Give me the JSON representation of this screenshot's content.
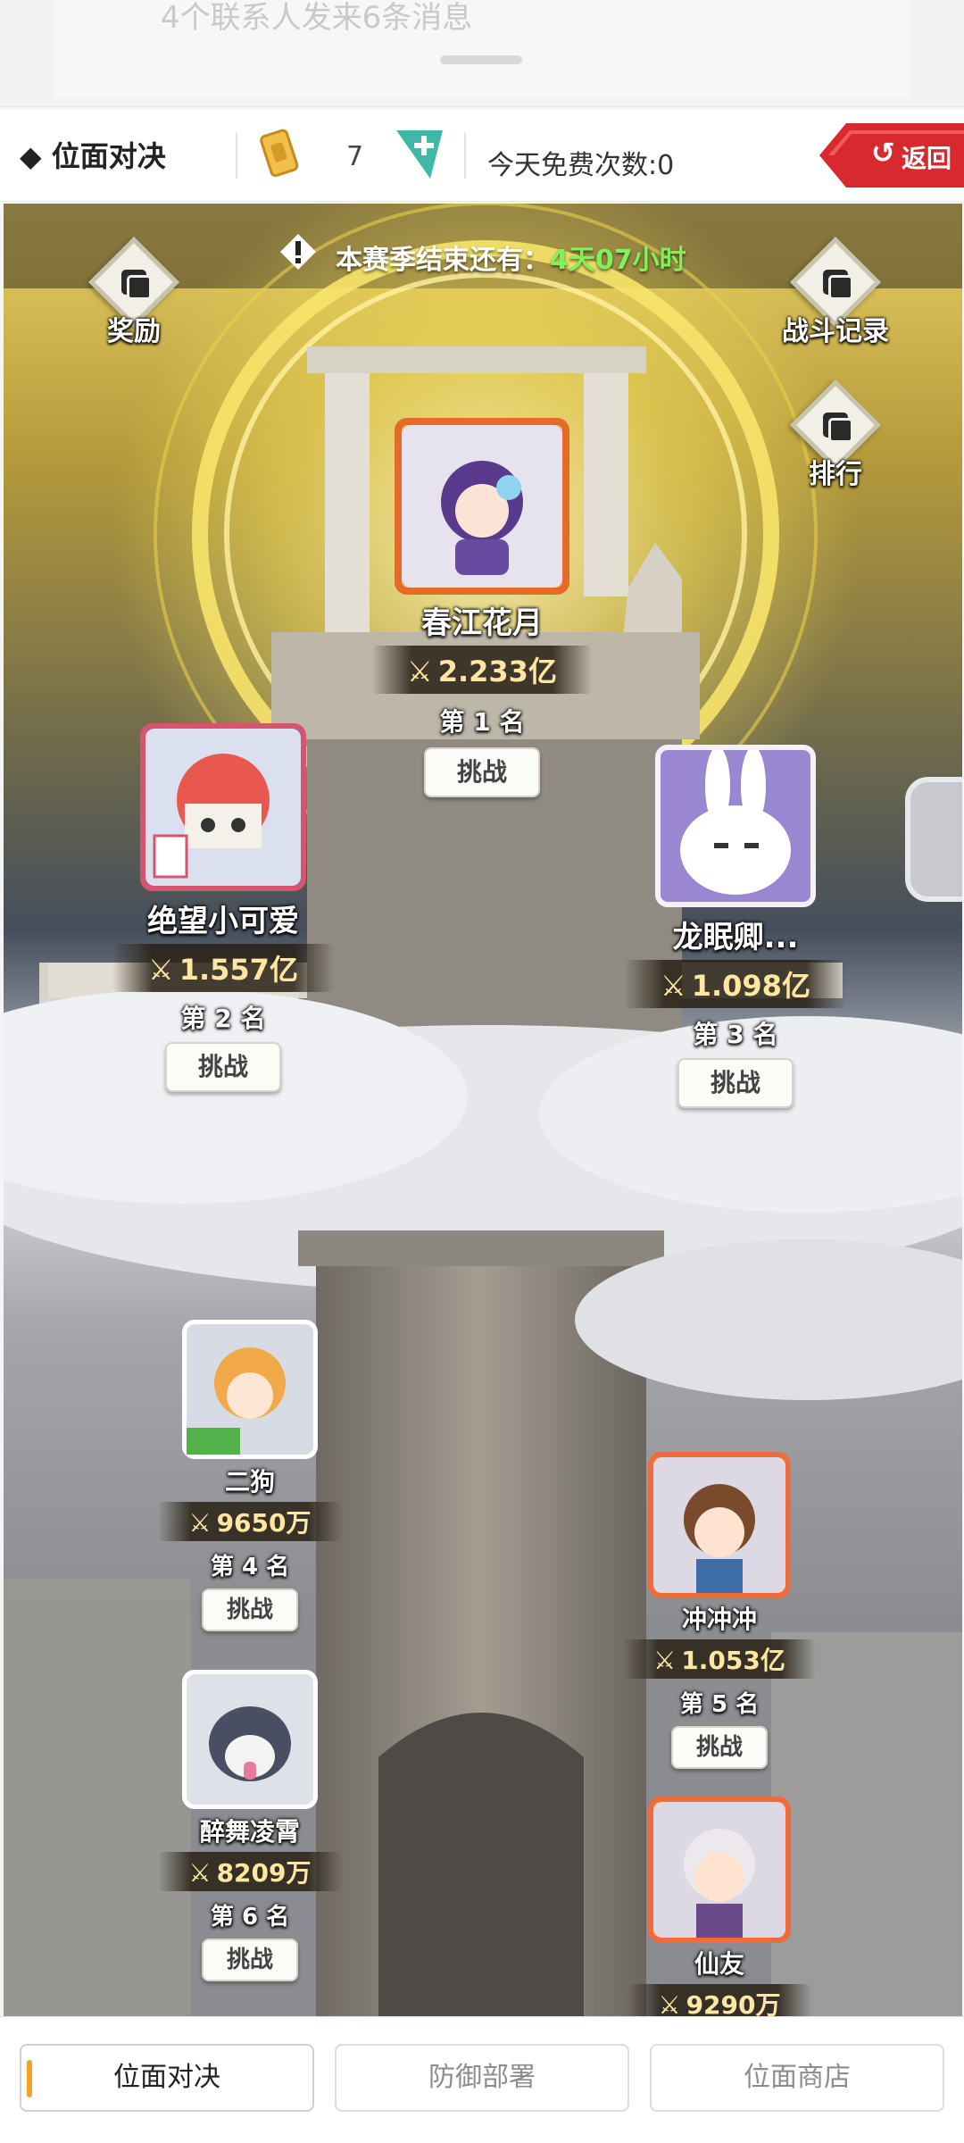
{
  "notification": {
    "text": "4个联系人发来6条消息"
  },
  "topbar": {
    "title": "◆ 位面对决",
    "ticket_count": "7",
    "free_times": "今天免费次数:0",
    "back_label": "返回",
    "back_arrow": "↺"
  },
  "season": {
    "label": "本赛季结束还有：",
    "time": "4天07小时"
  },
  "side_buttons": {
    "reward": "奖励",
    "battle_log": "战斗记录",
    "ranking": "排行"
  },
  "players": [
    {
      "name": "春江花月",
      "power": "2.233亿",
      "rank": "第 1 名",
      "challenge": "挑战"
    },
    {
      "name": "绝望小可爱",
      "power": "1.557亿",
      "rank": "第 2 名",
      "challenge": "挑战"
    },
    {
      "name": "龙眠卿...",
      "power": "1.098亿",
      "rank": "第 3 名",
      "challenge": "挑战"
    },
    {
      "name": "二狗",
      "power": "9650万",
      "rank": "第 4 名",
      "challenge": "挑战"
    },
    {
      "name": "冲冲冲",
      "power": "1.053亿",
      "rank": "第 5 名",
      "challenge": "挑战"
    },
    {
      "name": "醉舞凌霄",
      "power": "8209万",
      "rank": "第 6 名",
      "challenge": "挑战"
    },
    {
      "name": "仙友",
      "power": "9290万",
      "rank": "",
      "challenge": ""
    }
  ],
  "power_icon": "⚔",
  "bottom_tabs": [
    "位面对决",
    "防御部署",
    "位面商店"
  ],
  "colors": {
    "accent_red": "#d8292f",
    "timer_green": "#7df25a",
    "tab_accent": "#f0a428",
    "ticket_teal": "#3fb8a8"
  }
}
